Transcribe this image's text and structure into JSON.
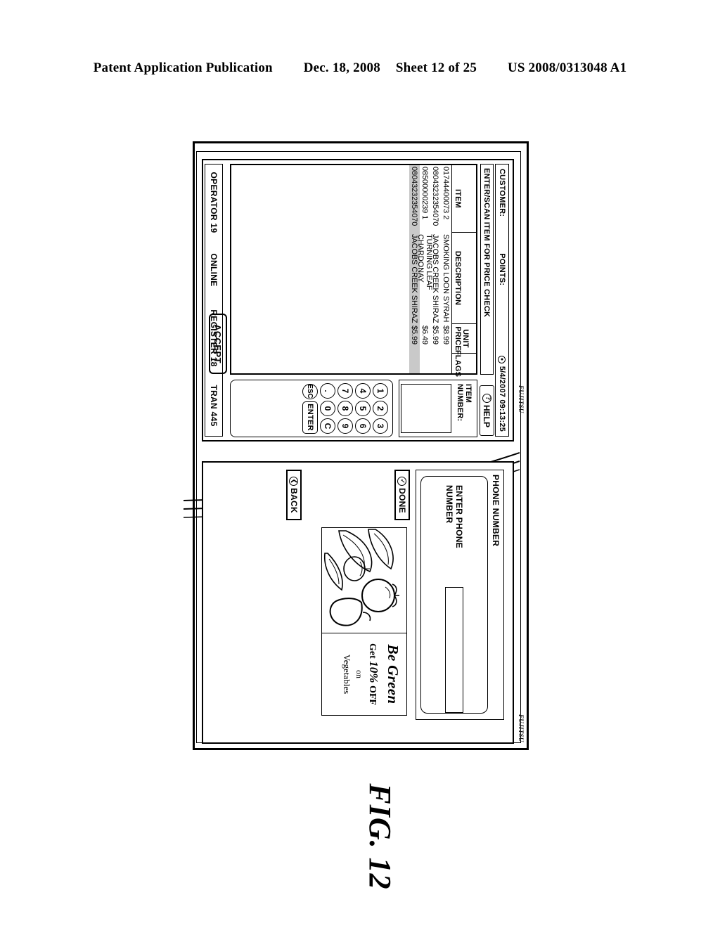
{
  "patent_header": {
    "publication": "Patent Application Publication",
    "date": "Dec. 18, 2008",
    "sheet": "Sheet 12 of 25",
    "number": "US 2008/0313048 A1"
  },
  "figure": {
    "caption": "FIG. 12"
  },
  "brand": {
    "fujitsu": "FUJITSU"
  },
  "operator_screen": {
    "top_strip": {
      "customer_label": "CUSTOMER:",
      "points_label": "POINTS:",
      "clock_icon": "clock-icon",
      "datetime": "5/4/2007 09:13:25"
    },
    "prompt": "ENTER/SCAN ITEM FOR PRICE CHECK",
    "help_button": {
      "icon": "question-mark-icon",
      "icon_glyph": "?",
      "label": "HELP"
    },
    "item_table": {
      "columns": [
        "ITEM",
        "DESCRIPTION",
        "UNIT",
        "PRICE",
        "FLAGS"
      ],
      "headers": {
        "item": "ITEM",
        "description": "DESCRIPTION",
        "unit": "UNIT",
        "price": "PRICE",
        "flags": "FLAGS"
      },
      "rows": [
        {
          "item": "01744400073 2",
          "description": "SMOKING LOON SYRAH",
          "unit_price": "$8.99",
          "flags": "",
          "selected": false
        },
        {
          "item": "08043232354070",
          "description": "JACOBS CREEK SHIRAZ",
          "unit_price": "$5.99",
          "flags": "",
          "selected": false
        },
        {
          "item": "08500000239 1",
          "description": "TURNING LEAF CHARDONAY",
          "unit_price": "$6.49",
          "flags": "",
          "selected": false
        },
        {
          "item": "08043232354070",
          "description": "JACOBS CREEK SHIRAZ",
          "unit_price": "$5.99",
          "flags": "",
          "selected": true
        }
      ]
    },
    "accept_button": "ACCEPT",
    "entry_pad": {
      "item_number_label": "ITEM NUMBER:",
      "item_number_value": "",
      "keys": [
        [
          "1",
          "2",
          "3"
        ],
        [
          "4",
          "5",
          "6"
        ],
        [
          "7",
          "8",
          "9"
        ],
        [
          ".",
          "0",
          "C"
        ]
      ],
      "esc_key": "ESC",
      "enter_key": "ENTER"
    },
    "status_bar": {
      "operator": "OPERATOR 19",
      "connection": "ONLINE",
      "register": "REGISTER 18",
      "transaction": "TRAN 445"
    }
  },
  "customer_screen": {
    "phone_panel": {
      "title": "PHONE NUMBER",
      "entry_label": "ENTER PHONE NUMBER",
      "entry_value": ""
    },
    "done_button": {
      "icon": "check-circle-icon",
      "icon_glyph": "✓",
      "label": "DONE"
    },
    "back_button": {
      "icon": "chevron-left-circle-icon",
      "icon_glyph": "❮",
      "label": "BACK"
    },
    "advertisement": {
      "image": "vegetables-photo",
      "brand": "Be Green",
      "line1_prefix": "Get ",
      "line1_value": "10%",
      "line1_suffix": " OFF",
      "line2": "on",
      "line3": "Vegetables"
    }
  }
}
